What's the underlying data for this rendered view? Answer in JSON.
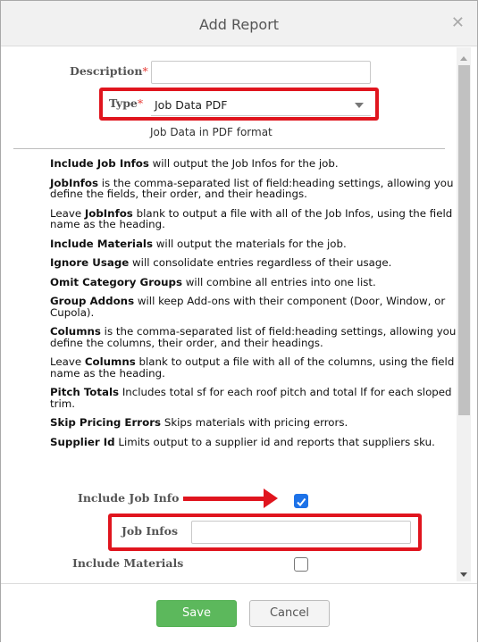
{
  "dialog": {
    "title": "Add Report"
  },
  "form": {
    "description_label": "Description",
    "required_mark": "*",
    "description_value": "",
    "type_label": "Type",
    "type_value": "Job Data PDF",
    "type_description": "Job Data in PDF format"
  },
  "help": [
    {
      "bold": "Include Job Infos",
      "text": " will output the Job Infos for the job."
    },
    {
      "bold": "JobInfos",
      "text": " is the comma-separated list of field:heading settings, allowing you to define the fields, their order, and their headings."
    },
    {
      "pre": "Leave ",
      "bold": "JobInfos",
      "text": " blank to output a file with all of the Job Infos, using the field name as the heading."
    },
    {
      "bold": "Include Materials",
      "text": " will output the materials for the job."
    },
    {
      "bold": "Ignore Usage",
      "text": " will consolidate entries regardless of their usage."
    },
    {
      "bold": "Omit Category Groups",
      "text": " will combine all entries into one list."
    },
    {
      "bold": "Group Addons",
      "text": " will keep Add-ons with their component (Door, Window, or Cupola)."
    },
    {
      "bold": "Columns",
      "text": " is the comma-separated list of field:heading settings, allowing you to define the columns, their order, and their headings."
    },
    {
      "pre": "Leave ",
      "bold": "Columns",
      "text": " blank to output a file with all of the columns, using the field name as the heading."
    },
    {
      "bold": "Pitch Totals",
      "text": " Includes total sf for each roof pitch and total lf for each sloped trim."
    },
    {
      "bold": "Skip Pricing Errors",
      "text": " Skips materials with pricing errors."
    },
    {
      "bold": "Supplier Id",
      "text": " Limits output to a supplier id and reports that suppliers sku."
    }
  ],
  "options": {
    "include_job_info_label": "Include Job Info",
    "include_job_info_checked": true,
    "job_infos_label": "Job Infos",
    "job_infos_value": "",
    "include_materials_label": "Include Materials",
    "include_materials_checked": false
  },
  "footer": {
    "save_label": "Save",
    "cancel_label": "Cancel"
  },
  "colors": {
    "save": "#5cb85c",
    "highlight": "#e0151e",
    "checkbox": "#1d72e8",
    "required": "#e8403a"
  }
}
